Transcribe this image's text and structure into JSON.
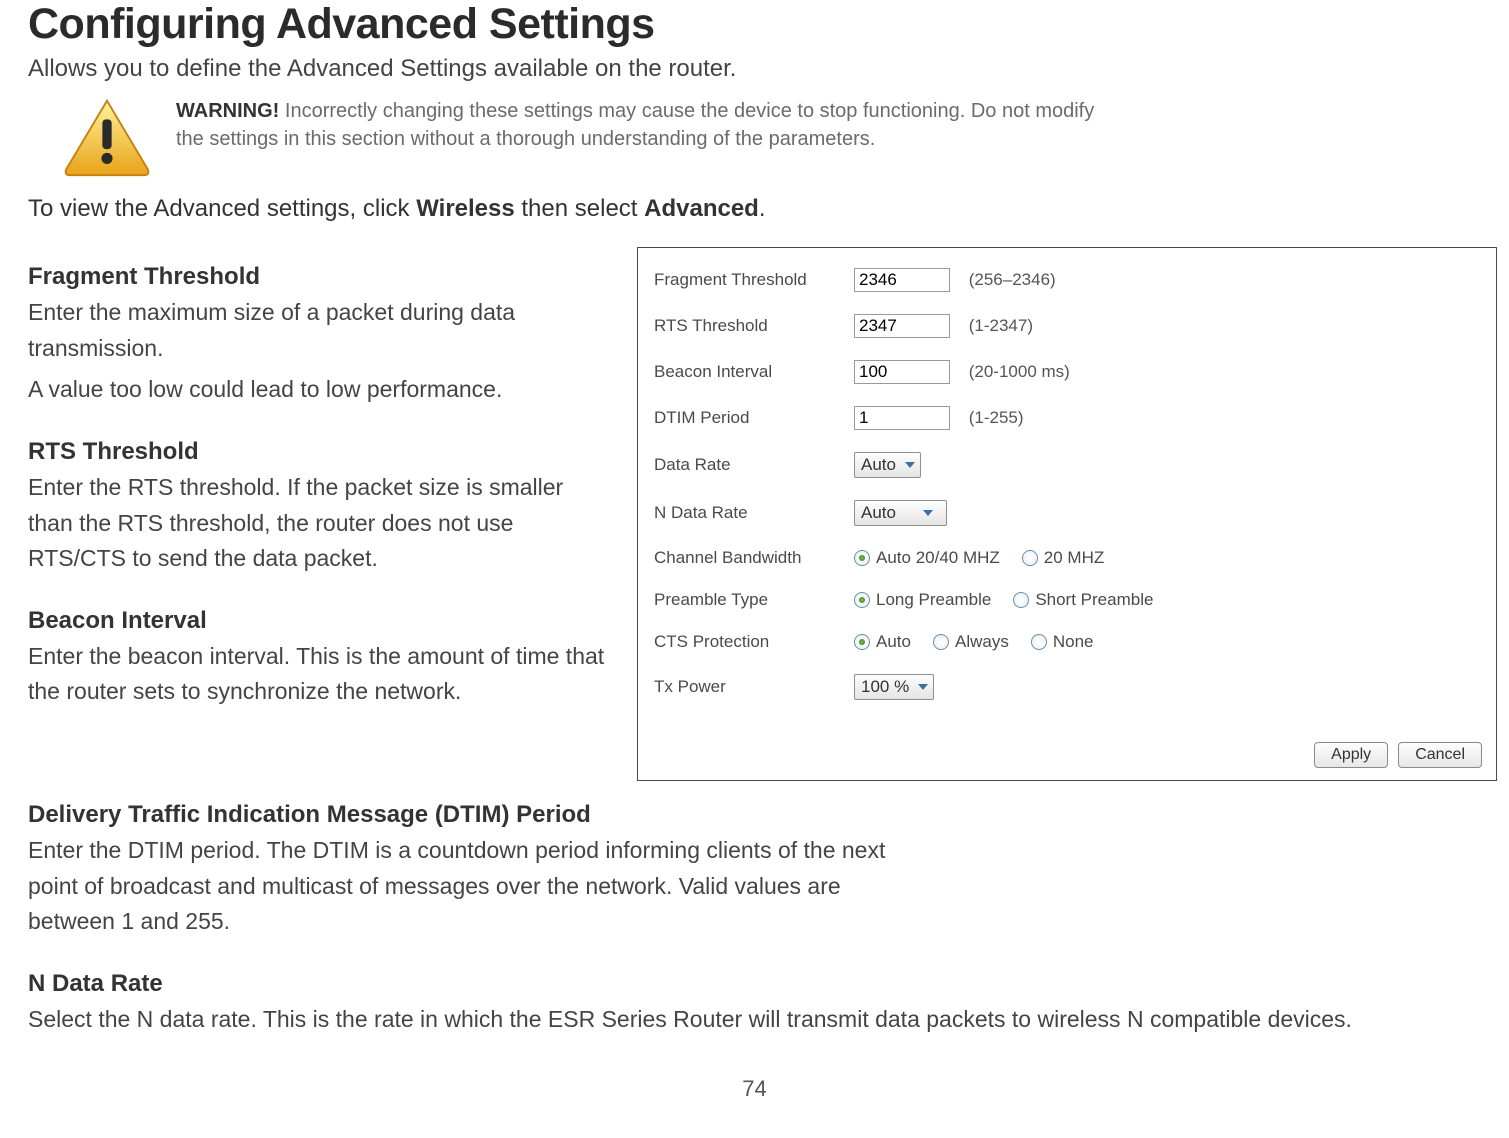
{
  "title": "Configuring Advanced Settings",
  "subtitle": "Allows you to define the Advanced Settings available on the router.",
  "warning": {
    "label": "WARNING!",
    "text_line1": "Incorrectly changing these settings may cause the device to stop functioning. Do not modify",
    "text_line2": "the settings in this section without a thorough understanding of the parameters."
  },
  "nav_line_prefix": "To view the Advanced settings, click ",
  "nav_word1": "Wireless",
  "nav_middle": " then select ",
  "nav_word2": "Advanced",
  "nav_period": ".",
  "sections": {
    "fragment": {
      "heading": "Fragment Threshold",
      "body_l1": "Enter the maximum size of a packet during data transmission.",
      "body_l2": "A value too low could lead to low performance."
    },
    "rts": {
      "heading": "RTS Threshold",
      "body": "Enter the RTS threshold. If the packet size is smaller than the RTS threshold, the router does not use RTS/CTS to send the data packet."
    },
    "beacon": {
      "heading": "Beacon Interval",
      "body": "Enter the beacon interval. This is the amount of time that the router sets to synchronize the network."
    },
    "dtim": {
      "heading": "Delivery Traffic Indication Message (DTIM) Period",
      "body": "Enter the DTIM period. The DTIM is a countdown period informing clients of the next point of broadcast and multicast of messages over the network. Valid values are between 1 and 255."
    },
    "ndata": {
      "heading": "N Data Rate",
      "body": "Select the N data rate. This is the rate in which the ESR Series Router will transmit data packets to wireless N compatible devices."
    }
  },
  "panel": {
    "rows": {
      "fragment": {
        "label": "Fragment Threshold",
        "value": "2346",
        "hint": "(256–2346)"
      },
      "rts": {
        "label": "RTS Threshold",
        "value": "2347",
        "hint": "(1-2347)"
      },
      "beacon": {
        "label": "Beacon Interval",
        "value": "100",
        "hint": "(20-1000 ms)"
      },
      "dtim": {
        "label": "DTIM Period",
        "value": "1",
        "hint": "(1-255)"
      },
      "datarate": {
        "label": "Data Rate",
        "value": "Auto"
      },
      "ndatarate": {
        "label": "N Data Rate",
        "value": "Auto"
      },
      "chanbw": {
        "label": "Channel Bandwidth",
        "opt1": "Auto 20/40 MHZ",
        "opt2": "20 MHZ"
      },
      "preamble": {
        "label": "Preamble Type",
        "opt1": "Long Preamble",
        "opt2": "Short Preamble"
      },
      "cts": {
        "label": "CTS Protection",
        "opt1": "Auto",
        "opt2": "Always",
        "opt3": "None"
      },
      "txpower": {
        "label": "Tx Power",
        "value": "100 %"
      }
    },
    "buttons": {
      "apply": "Apply",
      "cancel": "Cancel"
    }
  },
  "page_number": "74"
}
